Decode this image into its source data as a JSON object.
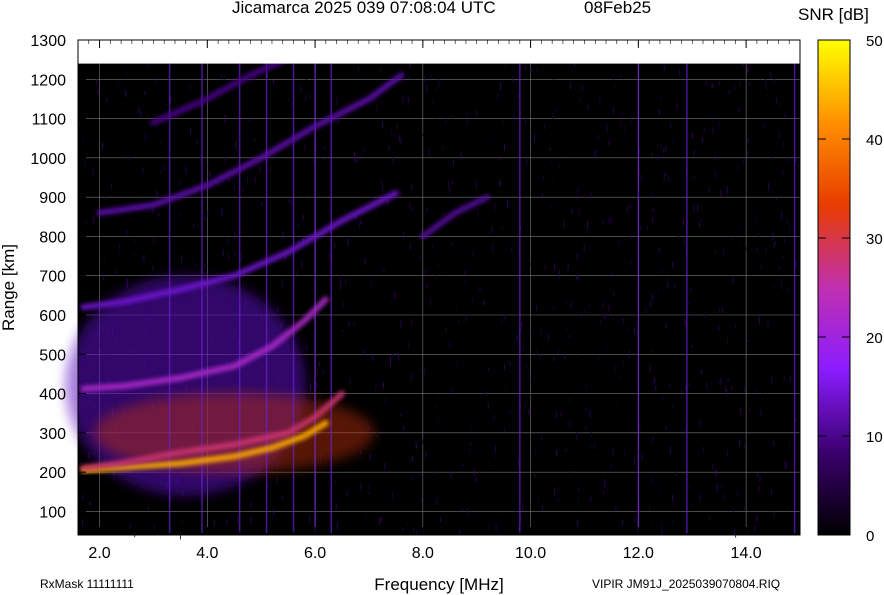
{
  "header": {
    "title": "Jicamarca 2025 039 07:08:04 UTC",
    "date": "08Feb25"
  },
  "footer": {
    "rxmask": "RxMask 11111111",
    "file": "VIPIR  JM91J_2025039070804.RIQ"
  },
  "colorbar": {
    "label": "SNR [dB]",
    "ticks": [
      "0",
      "10",
      "20",
      "30",
      "40",
      "50"
    ],
    "range": [
      0,
      50
    ],
    "colors": [
      "#000000",
      "#3a006e",
      "#8a1cff",
      "#c030b0",
      "#e83c00",
      "#ff9000",
      "#ffff00"
    ]
  },
  "chart_data": {
    "type": "heatmap",
    "xlabel": "Frequency [MHz]",
    "ylabel": "Range [km]",
    "xlim": [
      1.6,
      15.0
    ],
    "ylim": [
      40,
      1300
    ],
    "x_ticks": [
      "2.0",
      "4.0",
      "6.0",
      "8.0",
      "10.0",
      "12.0",
      "14.0"
    ],
    "y_ticks": [
      "100",
      "200",
      "300",
      "400",
      "500",
      "600",
      "700",
      "800",
      "900",
      "1000",
      "1100",
      "1200",
      "1300"
    ],
    "grid": true,
    "echo_traces": [
      {
        "name": "",
        "snr_db": 44,
        "points": [
          [
            1.7,
            205
          ],
          [
            2.5,
            212
          ],
          [
            3.5,
            222
          ],
          [
            4.5,
            240
          ],
          [
            5.2,
            262
          ],
          [
            5.8,
            292
          ],
          [
            6.2,
            325
          ]
        ]
      },
      {
        "name": "",
        "snr_db": 28,
        "points": [
          [
            1.7,
            210
          ],
          [
            2.5,
            225
          ],
          [
            3.5,
            250
          ],
          [
            4.5,
            270
          ],
          [
            5.5,
            300
          ],
          [
            6.0,
            340
          ],
          [
            6.5,
            400
          ]
        ]
      },
      {
        "name": "",
        "snr_db": 22,
        "points": [
          [
            1.7,
            412
          ],
          [
            2.5,
            420
          ],
          [
            3.5,
            440
          ],
          [
            4.5,
            470
          ],
          [
            5.2,
            520
          ],
          [
            5.8,
            585
          ],
          [
            6.2,
            640
          ]
        ]
      },
      {
        "name": "",
        "snr_db": 14,
        "points": [
          [
            1.7,
            620
          ],
          [
            2.5,
            635
          ],
          [
            3.5,
            665
          ],
          [
            4.5,
            700
          ],
          [
            5.5,
            760
          ],
          [
            6.5,
            840
          ],
          [
            7.5,
            910
          ]
        ]
      },
      {
        "name": "",
        "snr_db": 12,
        "points": [
          [
            2.0,
            860
          ],
          [
            3.0,
            880
          ],
          [
            4.0,
            930
          ],
          [
            5.0,
            1000
          ],
          [
            6.0,
            1080
          ],
          [
            7.0,
            1150
          ],
          [
            7.6,
            1210
          ]
        ]
      },
      {
        "name": "",
        "snr_db": 10,
        "points": [
          [
            3.0,
            1090
          ],
          [
            4.0,
            1150
          ],
          [
            4.8,
            1210
          ],
          [
            5.6,
            1260
          ]
        ]
      },
      {
        "name": "",
        "snr_db": 11,
        "points": [
          [
            8.0,
            800
          ],
          [
            8.6,
            860
          ],
          [
            9.2,
            900
          ]
        ]
      }
    ],
    "interference_lines_mhz": [
      3.3,
      3.9,
      4.6,
      5.1,
      5.6,
      6.0,
      6.3,
      9.8,
      12.0,
      12.9,
      14.9
    ]
  }
}
